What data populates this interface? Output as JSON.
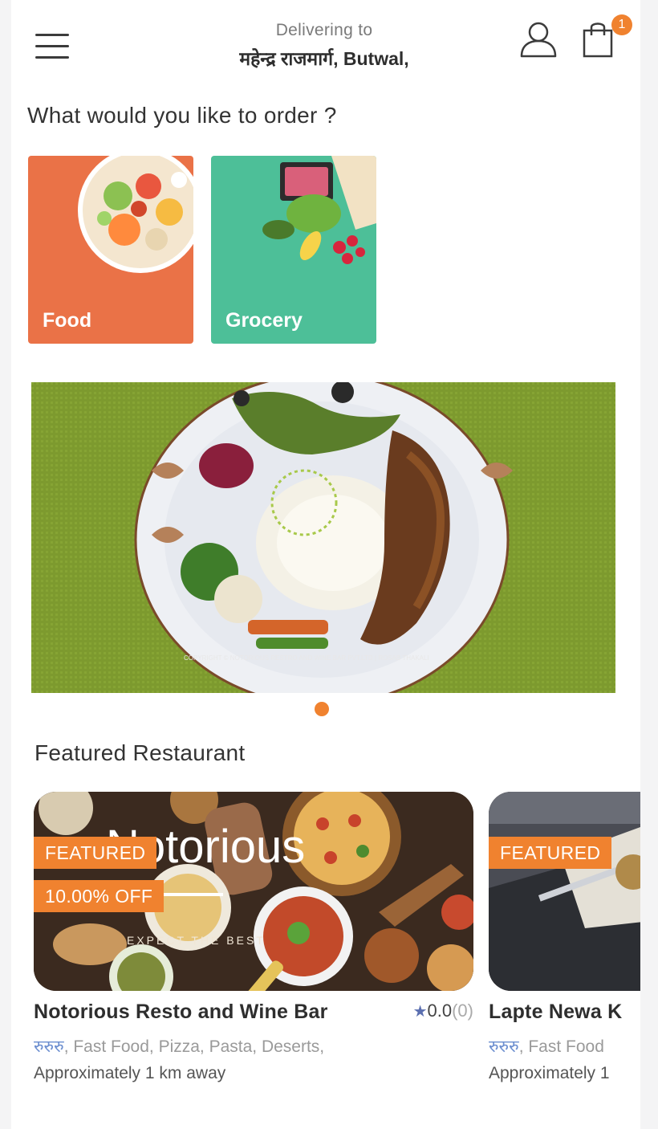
{
  "header": {
    "delivering_label": "Delivering to",
    "address": "महेन्द्र राजमार्ग, Butwal,",
    "cart_count": "1"
  },
  "question": "What would you like to order ?",
  "categories": [
    {
      "label": "Food",
      "color": "#ea7247"
    },
    {
      "label": "Grocery",
      "color": "#4dbf98"
    }
  ],
  "banner": {
    "watermark": "COPYRIGHT © NOTORIOUS RESTRO AND WINE BAR PVT.LTD | ROSAB THAKALI"
  },
  "carousel": {
    "active_index": 0
  },
  "featured_section_title": "Featured Restaurant",
  "restaurants": [
    {
      "featured_label": "FEATURED",
      "discount": "10.00% OFF",
      "overlay_text": "Notorious",
      "overlay_tagline": "EXPECT THE BEST",
      "name": "Notorious Resto and Wine Bar",
      "rating": "0.0",
      "rating_count": "(0)",
      "price_level": "रुरुरु",
      "cuisines": ", Fast Food,  Pizza,  Pasta,  Deserts,",
      "distance": "Approximately 1 km away"
    },
    {
      "featured_label": "FEATURED",
      "name": "Lapte Newa K",
      "price_level": "रुरुरु",
      "cuisines": ", Fast Food",
      "distance": "Approximately 1"
    }
  ],
  "colors": {
    "accent": "#f0822f",
    "food": "#ea7247",
    "grocery": "#4dbf98",
    "rating_star": "#5b6fb0"
  }
}
